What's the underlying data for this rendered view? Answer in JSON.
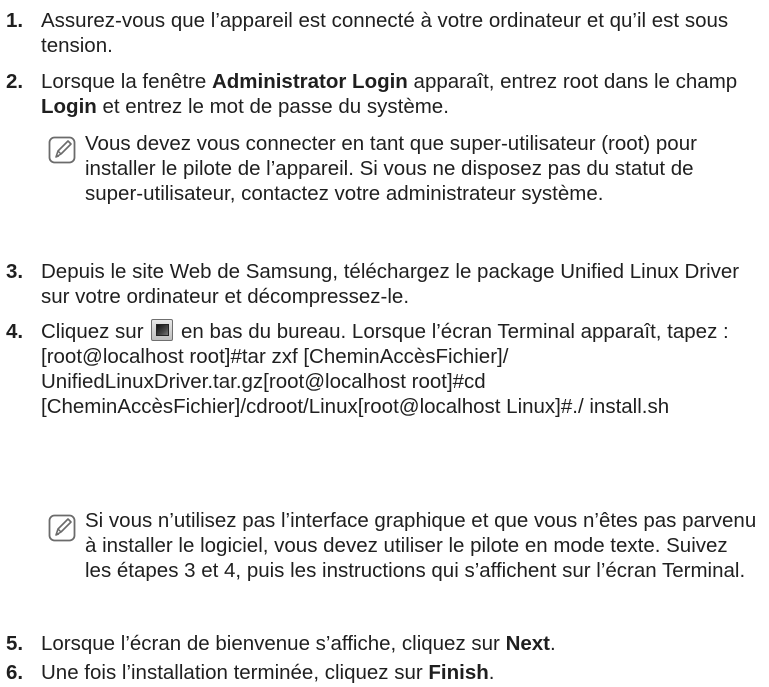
{
  "steps": [
    {
      "num": "1.",
      "text": "Assurez-vous que l’appareil est connecté à votre ordinateur et qu’il est sous tension."
    },
    {
      "num": "2.",
      "t1": "Lorsque la fenêtre ",
      "b1": "Administrator Login",
      "t2": " apparaît, entrez root dans le champ ",
      "b2": "Login",
      "t3": " et entrez le mot de passe du système."
    },
    {
      "num": "3.",
      "text": "Depuis le site Web de Samsung, téléchargez le package Unified Linux Driver sur votre ordinateur et décompressez-le."
    },
    {
      "num": "4.",
      "t1": "Cliquez sur ",
      "t2": " en bas du bureau. Lorsque l’écran Terminal apparaît, tapez :",
      "code": "[root@localhost root]#tar zxf [CheminAccèsFichier]/ UnifiedLinuxDriver.tar.gz[root@localhost root]#cd [CheminAccèsFichier]/cdroot/Linux[root@localhost Linux]#./ install.sh"
    },
    {
      "num": "5.",
      "t1": "Lorsque l’écran de bienvenue s’affiche, cliquez sur ",
      "b1": "Next",
      "t2": "."
    },
    {
      "num": "6.",
      "t1": "Une fois l’installation terminée, cliquez sur ",
      "b1": "Finish",
      "t2": "."
    }
  ],
  "notes": [
    {
      "text": "Vous devez vous connecter en tant que super-utilisateur (root) pour installer le pilote de l’appareil. Si vous ne disposez pas du statut de super-utilisateur, contactez votre administrateur système."
    },
    {
      "text": "Si vous n’utilisez pas l’interface graphique et que vous n’êtes pas parvenu à installer le logiciel, vous devez utiliser le pilote en mode texte. Suivez les étapes 3 et 4, puis les instructions qui s’affichent sur l’écran Terminal."
    }
  ],
  "icons": {
    "note": "note-pencil-icon",
    "terminal": "terminal-icon"
  },
  "colors": {
    "text": "#1f1f1f",
    "icon_stroke": "#6b6b6b"
  }
}
